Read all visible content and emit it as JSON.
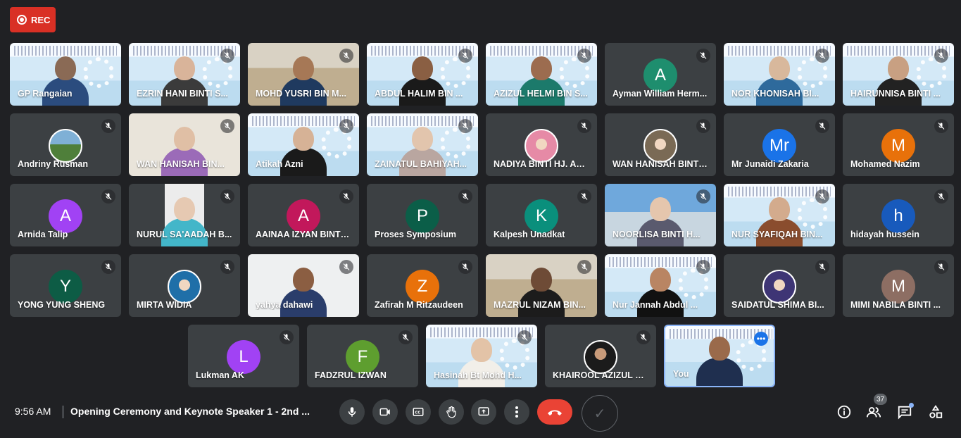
{
  "recording": {
    "label": "REC",
    "color": "#d93025"
  },
  "participants": [
    [
      {
        "name": "GP Rangaian",
        "kind": "video",
        "bg": "banner",
        "skin": "#8a6a55",
        "shirt": "#2b4c7e"
      },
      {
        "name": "EZRIN HANI BINTI S...",
        "kind": "video",
        "bg": "banner",
        "skin": "#d9b49a",
        "shirt": "#3b3b3b",
        "mic_off": true
      },
      {
        "name": "MOHD YUSRI BIN M...",
        "kind": "video",
        "bg": "room",
        "skin": "#a67856",
        "shirt": "#1f3a5f",
        "mic_off": true
      },
      {
        "name": "ABDUL HALIM BIN ...",
        "kind": "video",
        "bg": "banner",
        "skin": "#8a5f43",
        "shirt": "#1a1a1a",
        "mic_off": true
      },
      {
        "name": "AZIZUL HELMI BIN S...",
        "kind": "video",
        "bg": "banner",
        "skin": "#9c6c4f",
        "shirt": "#1c7a6b",
        "mic_off": true
      },
      {
        "name": "Ayman William Herm...",
        "kind": "avatar",
        "initial": "A",
        "color": "#1e8e6e",
        "mic_off": true
      },
      {
        "name": "NOR KHONISAH BI...",
        "kind": "video",
        "bg": "banner",
        "skin": "#d8b89c",
        "shirt": "#2e6a9c",
        "mic_off": true
      },
      {
        "name": "HAIRUNNISA BINTI ...",
        "kind": "video",
        "bg": "banner",
        "skin": "#c8a082",
        "shirt": "#222222",
        "mic_off": true
      }
    ],
    [
      {
        "name": "Andriny Rusman",
        "kind": "photo",
        "photo": "mountain",
        "mic_off": true
      },
      {
        "name": "WAN HANISAH BIN...",
        "kind": "video",
        "bg": "kitchen",
        "skin": "#e0bfa5",
        "shirt": "#9b6bb8",
        "mic_off": true
      },
      {
        "name": "Atikah Azni",
        "kind": "video",
        "bg": "banner",
        "skin": "#d6b296",
        "shirt": "#1a1a1a",
        "mic_off": true
      },
      {
        "name": "ZAINATUL BAHIYAH...",
        "kind": "video",
        "bg": "banner",
        "skin": "#e2c5ad",
        "shirt": "#b9a6a0",
        "mic_off": true
      },
      {
        "name": "NADIYA BINTI HJ. AB...",
        "kind": "photo",
        "photo": "hijab-p",
        "mic_off": true
      },
      {
        "name": "WAN HANISAH BINTI...",
        "kind": "photo",
        "photo": "hijab-g",
        "mic_off": true
      },
      {
        "name": "Mr Junaidi Zakaria",
        "kind": "avatar",
        "initial": "Mr",
        "color": "#1a73e8",
        "mic_off": true
      },
      {
        "name": "Mohamed Nazim",
        "kind": "avatar",
        "initial": "M",
        "color": "#e8710a",
        "mic_off": true
      }
    ],
    [
      {
        "name": "Arnida Talip",
        "kind": "avatar",
        "initial": "A",
        "color": "#a142f4",
        "mic_off": true
      },
      {
        "name": "NURUL SA'AADAH B...",
        "kind": "video",
        "bg": "portrait",
        "skin": "#e6c9b2",
        "shirt": "#43b6c9",
        "mic_off": true
      },
      {
        "name": "AAINAA IZYAN BINTI ...",
        "kind": "avatar",
        "initial": "A",
        "color": "#c2185b",
        "mic_off": true
      },
      {
        "name": "Proses Symposium",
        "kind": "avatar",
        "initial": "P",
        "color": "#0b5e48",
        "mic_off": true
      },
      {
        "name": "Kalpesh Unadkat",
        "kind": "avatar",
        "initial": "K",
        "color": "#0a8f7c",
        "mic_off": true
      },
      {
        "name": "NOORLISA BINTI H...",
        "kind": "video",
        "bg": "building",
        "skin": "#e5c6ad",
        "shirt": "#5a5a6e",
        "mic_off": true
      },
      {
        "name": "NUR SYAFIQAH BIN...",
        "kind": "video",
        "bg": "banner",
        "skin": "#d3ab8d",
        "shirt": "#8a4d2e",
        "mic_off": true
      },
      {
        "name": "hidayah hussein",
        "kind": "avatar",
        "initial": "h",
        "color": "#185abc",
        "mic_off": true
      }
    ],
    [
      {
        "name": "YONG YUNG SHENG",
        "kind": "avatar",
        "initial": "Y",
        "color": "#0d5c45",
        "mic_off": true
      },
      {
        "name": "MIRTA WIDIA",
        "kind": "photo",
        "photo": "hijab-b",
        "mic_off": true
      },
      {
        "name": "yahya dahawi",
        "kind": "video",
        "bg": "office",
        "skin": "#8b5e42",
        "shirt": "#2a3d6b",
        "mic_off": true
      },
      {
        "name": "Zafirah M Ritzaudeen",
        "kind": "avatar",
        "initial": "Z",
        "color": "#e8710a",
        "mic_off": true
      },
      {
        "name": "MAZRUL NIZAM BIN...",
        "kind": "video",
        "bg": "room",
        "skin": "#6e4b36",
        "shirt": "#1c1c1c",
        "mic_off": true
      },
      {
        "name": "Nur Jannah Abdul ...",
        "kind": "video",
        "bg": "banner",
        "skin": "#b98563",
        "shirt": "#111111",
        "mic_off": true
      },
      {
        "name": "SAIDATUL SHIMA BI...",
        "kind": "photo",
        "photo": "hijab-n",
        "mic_off": true
      },
      {
        "name": "MIMI NABILA BINTI ...",
        "kind": "avatar",
        "initial": "M",
        "color": "#8d6e63",
        "mic_off": true
      }
    ],
    [
      {
        "name": "Lukman AK",
        "kind": "avatar",
        "initial": "L",
        "color": "#a142f4",
        "mic_off": true
      },
      {
        "name": "FADZRUL IZWAN",
        "kind": "avatar",
        "initial": "F",
        "color": "#5e9e2f",
        "mic_off": true
      },
      {
        "name": "Hasinah Bt Mohd H...",
        "kind": "video",
        "bg": "banner",
        "skin": "#e3c3a7",
        "shirt": "#f2efe9",
        "mic_off": true
      },
      {
        "name": "KHAIROOL AZIZUL B...",
        "kind": "photo",
        "photo": "man",
        "mic_off": true
      },
      {
        "name": "You",
        "kind": "video",
        "bg": "banner",
        "skin": "#9a6a4b",
        "shirt": "#1f2f4f",
        "self": true
      }
    ]
  ],
  "bottombar": {
    "time": "9:56 AM",
    "meeting_title": "Opening Ceremony and Keynote Speaker 1 - 2nd ...",
    "people_count": "37"
  }
}
